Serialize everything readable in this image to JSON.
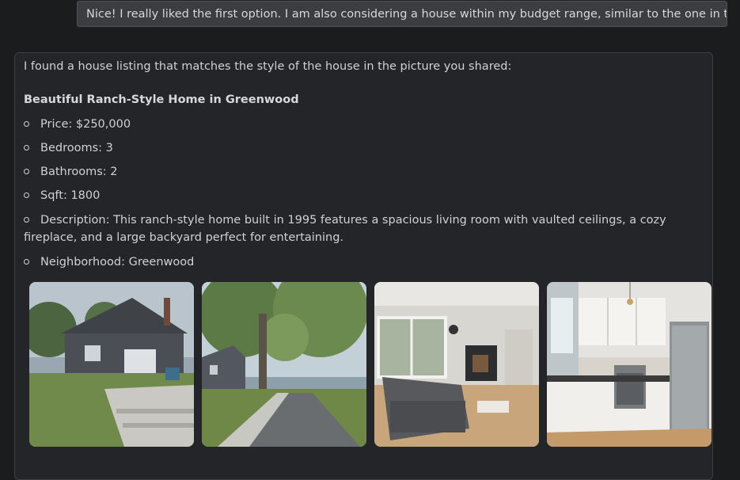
{
  "user_message": "Nice! I really liked the first option. I am also considering a house within my budget range, similar to the one in the picture.",
  "assistant": {
    "intro": "I found a house listing that matches the style of the house in the picture you shared:",
    "listing_title": "Beautiful Ranch-Style Home in Greenwood",
    "details": [
      "Price: $250,000",
      "Bedrooms: 3",
      "Bathrooms: 2",
      "Sqft: 1800",
      "Description: This ranch-style home built in 1995 features a spacious living room with vaulted ceilings, a cozy fireplace, and a large backyard perfect for entertaining.",
      "Neighborhood: Greenwood"
    ],
    "photos": [
      {
        "subject": "house-backyard-exterior"
      },
      {
        "subject": "tree-lined-street"
      },
      {
        "subject": "living-room-interior"
      },
      {
        "subject": "kitchen-interior"
      }
    ]
  },
  "colors": {
    "page_background": "#1b1c1e",
    "user_bubble": "#3b3d40",
    "assistant_card": "#242528",
    "text": "#d3d5d8"
  }
}
